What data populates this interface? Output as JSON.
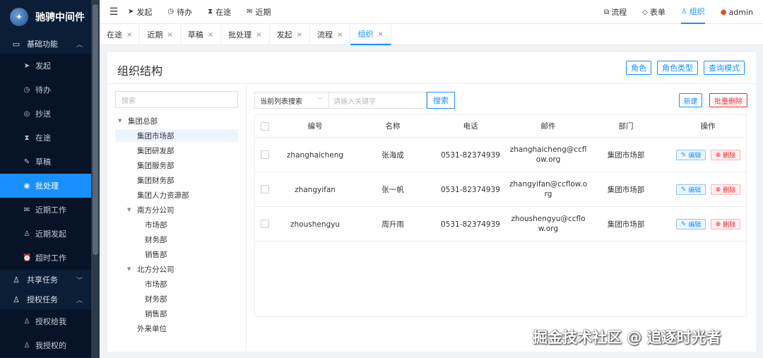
{
  "sidebar": {
    "logo": "驰骋中间件",
    "groups": [
      {
        "label": "基础功能",
        "icon": "folder-icon"
      },
      {
        "label": "共享任务",
        "icon": "share-icon"
      },
      {
        "label": "授权任务",
        "icon": "user-icon"
      }
    ],
    "items": [
      {
        "label": "发起",
        "icon": "send-icon"
      },
      {
        "label": "待办",
        "icon": "clock-icon"
      },
      {
        "label": "抄送",
        "icon": "copy-icon"
      },
      {
        "label": "在途",
        "icon": "hourglass-icon"
      },
      {
        "label": "草稿",
        "icon": "edit-icon"
      },
      {
        "label": "批处理",
        "icon": "batch-icon"
      },
      {
        "label": "近期工作",
        "icon": "mail-icon"
      },
      {
        "label": "近期发起",
        "icon": "user-icon"
      },
      {
        "label": "超时工作",
        "icon": "alarm-icon"
      }
    ],
    "sub_items": [
      {
        "label": "授权给我",
        "icon": "user-icon"
      },
      {
        "label": "我授权的",
        "icon": "user-icon"
      }
    ]
  },
  "header": {
    "nav": [
      {
        "label": "发起",
        "icon": "send-icon"
      },
      {
        "label": "待办",
        "icon": "clock-icon"
      },
      {
        "label": "在途",
        "icon": "hourglass-icon"
      },
      {
        "label": "近期",
        "icon": "mail-icon"
      }
    ],
    "right": [
      {
        "label": "流程",
        "icon": "flow-icon"
      },
      {
        "label": "表单",
        "icon": "diamond-icon"
      },
      {
        "label": "组织",
        "icon": "org-icon"
      },
      {
        "label": "admin",
        "icon": "avatar-icon"
      }
    ]
  },
  "tabs": [
    "在途",
    "近期",
    "草稿",
    "批处理",
    "发起",
    "流程",
    "组织"
  ],
  "page": {
    "title": "组织结构",
    "top_buttons": [
      "角色",
      "角色类型",
      "查询模式"
    ]
  },
  "tree": {
    "search_placeholder": "搜索",
    "nodes": [
      "集团总部",
      "集团市场部",
      "集团研发部",
      "集团服务部",
      "集团财务部",
      "集团人力资源部",
      "南方分公司",
      "市场部",
      "财务部",
      "销售部",
      "北方分公司",
      "市场部",
      "财务部",
      "销售部",
      "外来单位"
    ]
  },
  "search": {
    "select_value": "当前列表搜索",
    "input_placeholder": "请输入关键字",
    "button": "搜索",
    "new_button": "新建",
    "batch_delete_button": "批量删除"
  },
  "table": {
    "headers": [
      "编号",
      "名称",
      "电话",
      "邮件",
      "部门",
      "操作"
    ],
    "edit_label": "编辑",
    "delete_label": "删除",
    "rows": [
      {
        "id": "zhanghaicheng",
        "name": "张海成",
        "phone": "0531-82374939",
        "email1": "zhanghaicheng@ccfl",
        "email2": "ow.org",
        "dept": "集团市场部"
      },
      {
        "id": "zhangyifan",
        "name": "张一帆",
        "phone": "0531-82374939",
        "email1": "zhangyifan@ccflow.o",
        "email2": "rg",
        "dept": "集团市场部"
      },
      {
        "id": "zhoushengyu",
        "name": "周升雨",
        "phone": "0531-82374939",
        "email1": "zhoushengyu@ccflo",
        "email2": "w.org",
        "dept": "集团市场部"
      }
    ]
  },
  "watermark": "掘金技术社区 @ 追逐时光者"
}
